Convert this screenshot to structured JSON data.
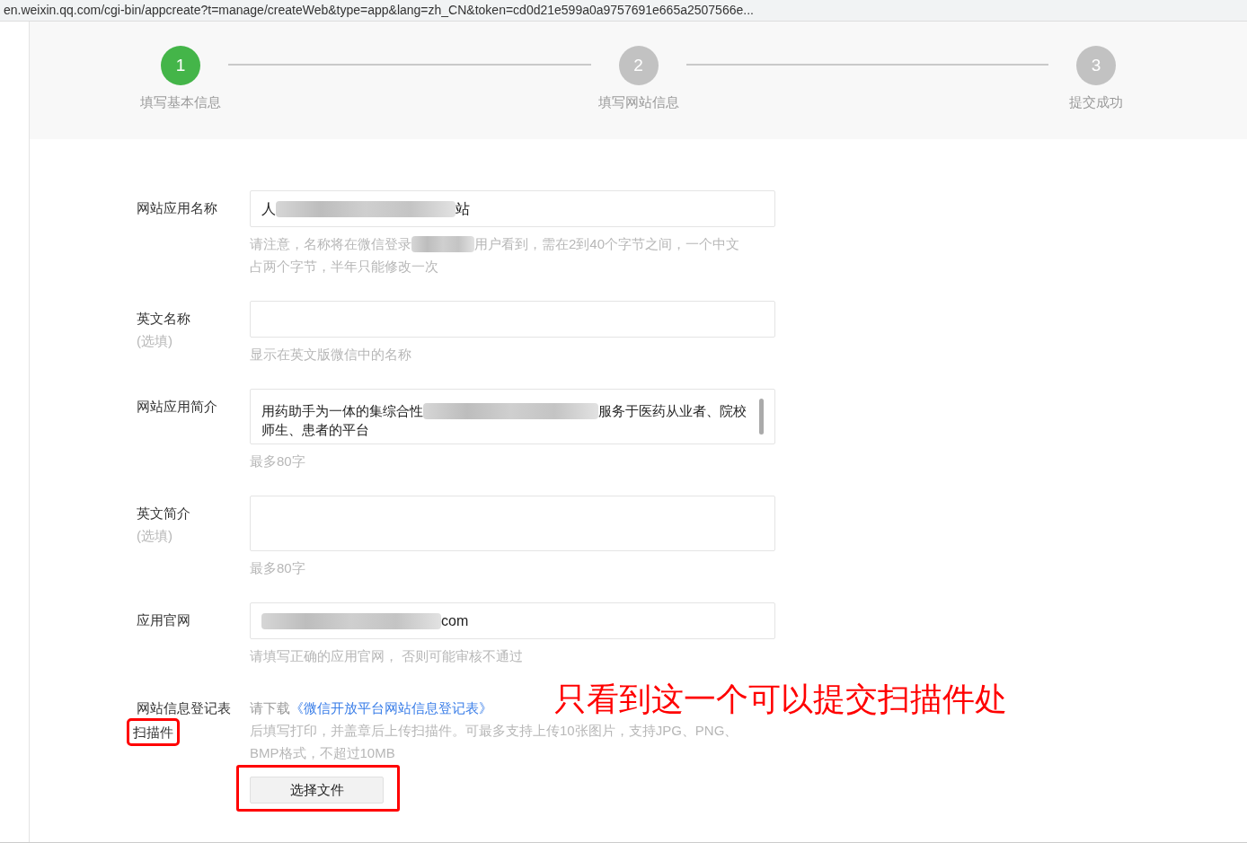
{
  "address_bar": {
    "url": "en.weixin.qq.com/cgi-bin/appcreate?t=manage/createWeb&type=app&lang=zh_CN&token=cd0d21e599a0a9757691e665a2507566e..."
  },
  "steps": [
    {
      "number": "1",
      "label": "填写基本信息",
      "selected": true
    },
    {
      "number": "2",
      "label": "填写网站信息",
      "selected": false
    },
    {
      "number": "3",
      "label": "提交成功",
      "selected": false
    }
  ],
  "fields": [
    {
      "kind": "input",
      "label": "网站应用名称",
      "value": [
        {
          "text": "人"
        },
        {
          "kind": "blur"
        },
        {
          "text": "站"
        }
      ],
      "hint": [
        [
          {
            "text": "请注意，名称将在微信登录"
          },
          {
            "kind": "blur"
          },
          {
            "text": "用户看到，需在2到40个字节之间，一个中文"
          }
        ],
        [
          {
            "text": "占两个字节，半年只能修改一次"
          }
        ]
      ]
    },
    {
      "kind": "input",
      "label": "英文名称",
      "optional": "(选填)",
      "hint": [
        [
          {
            "text": "显示在英文版微信中的名称"
          }
        ]
      ]
    },
    {
      "kind": "textarea",
      "label": "网站应用简介",
      "lines": [
        [
          {
            "text": "用药助手为一体的集综合性"
          },
          {
            "kind": "blur"
          },
          {
            "text": "服务于医药从业者、院校"
          }
        ],
        [
          {
            "text": "师生、患者的平台"
          }
        ]
      ],
      "hint": [
        [
          {
            "text": "最多80字"
          }
        ]
      ]
    },
    {
      "kind": "textarea",
      "label": "英文简介",
      "optional": "(选填)",
      "hint": [
        [
          {
            "text": "最多80字"
          }
        ]
      ]
    },
    {
      "kind": "input",
      "label": "应用官网",
      "value": [
        {
          "kind": "blur"
        },
        {
          "text": "com"
        }
      ],
      "hint": [
        [
          {
            "text": "请填写正确的应用官网， 否则可能审核不通过"
          }
        ]
      ]
    },
    {
      "kind": "upload",
      "label": "网站信息登记表",
      "label_2": "扫描件",
      "intro": "请下载",
      "link": "《微信开放平台网站信息登记表》",
      "hint": [
        [
          {
            "text": "后填写打印，并盖章后上传扫描件。可最多支持上传10张图片，支持JPG、PNG、"
          }
        ],
        [
          {
            "text": "BMP格式，不超过10MB"
          }
        ]
      ],
      "button": "选择文件"
    }
  ],
  "annotation": {
    "text": "只看到这一个可以提交扫描件处"
  }
}
